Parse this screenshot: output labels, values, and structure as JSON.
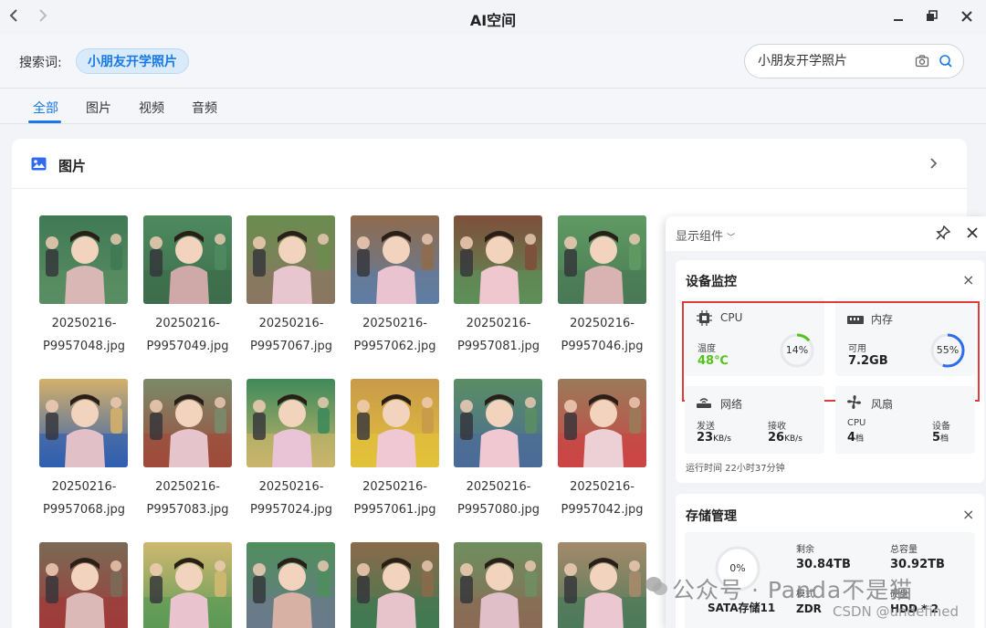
{
  "window": {
    "title": "AI空间"
  },
  "search": {
    "label": "搜索词:",
    "chip": "小朋友开学照片",
    "value": "小朋友开学照片"
  },
  "tabs": [
    {
      "label": "全部",
      "active": true
    },
    {
      "label": "图片",
      "active": false
    },
    {
      "label": "视频",
      "active": false
    },
    {
      "label": "音频",
      "active": false
    }
  ],
  "section": {
    "title": "图片"
  },
  "photos": [
    {
      "name": "20250216-P9957048.jpg"
    },
    {
      "name": "20250216-P9957049.jpg"
    },
    {
      "name": "20250216-P9957067.jpg"
    },
    {
      "name": "20250216-P9957062.jpg"
    },
    {
      "name": "20250216-P9957081.jpg"
    },
    {
      "name": "20250216-P9957046.jpg"
    },
    {
      "name": "20250216-P9957068.jpg"
    },
    {
      "name": "20250216-P9957083.jpg"
    },
    {
      "name": "20250216-P9957024.jpg"
    },
    {
      "name": "20250216-P9957061.jpg"
    },
    {
      "name": "20250216-P9957080.jpg"
    },
    {
      "name": "20250216-P9957042.jpg"
    }
  ],
  "panel": {
    "header": "显示组件",
    "monitor": {
      "title": "设备监控",
      "cpu": {
        "name": "CPU",
        "temp_label": "温度",
        "temp": "48℃",
        "usage": 14,
        "usage_text": "14%"
      },
      "memory": {
        "name": "内存",
        "avail_label": "可用",
        "avail": "7.2GB",
        "usage": 55,
        "usage_text": "55%"
      },
      "network": {
        "name": "网络",
        "send_label": "发送",
        "send": "23",
        "send_unit": "KB/s",
        "recv_label": "接收",
        "recv": "26",
        "recv_unit": "KB/s"
      },
      "fan": {
        "name": "风扇",
        "cpu_label": "CPU",
        "cpu": "4",
        "cpu_unit": "档",
        "dev_label": "设备",
        "dev": "5",
        "dev_unit": "档"
      },
      "uptime": "运行时间 22小时37分钟"
    },
    "storage": {
      "title": "存储管理",
      "usage_text": "0%",
      "pool": "SATA存储11",
      "remain_label": "剩余",
      "remain": "30.84TB",
      "total_label": "总容量",
      "total": "30.92TB",
      "mode_label": "模式",
      "mode": "ZDR",
      "disk_label": "硬盘",
      "disk": "HDD * 2"
    }
  },
  "watermarks": {
    "line1": "公众号 · Panda不是猫",
    "line2": "CSDN @undefined"
  },
  "colors": {
    "accent": "#1778e6",
    "highlight": "#e23b3b",
    "cpu_ring": "#52c41a",
    "mem_ring": "#2f6bf0",
    "temp": "#52c41a"
  }
}
